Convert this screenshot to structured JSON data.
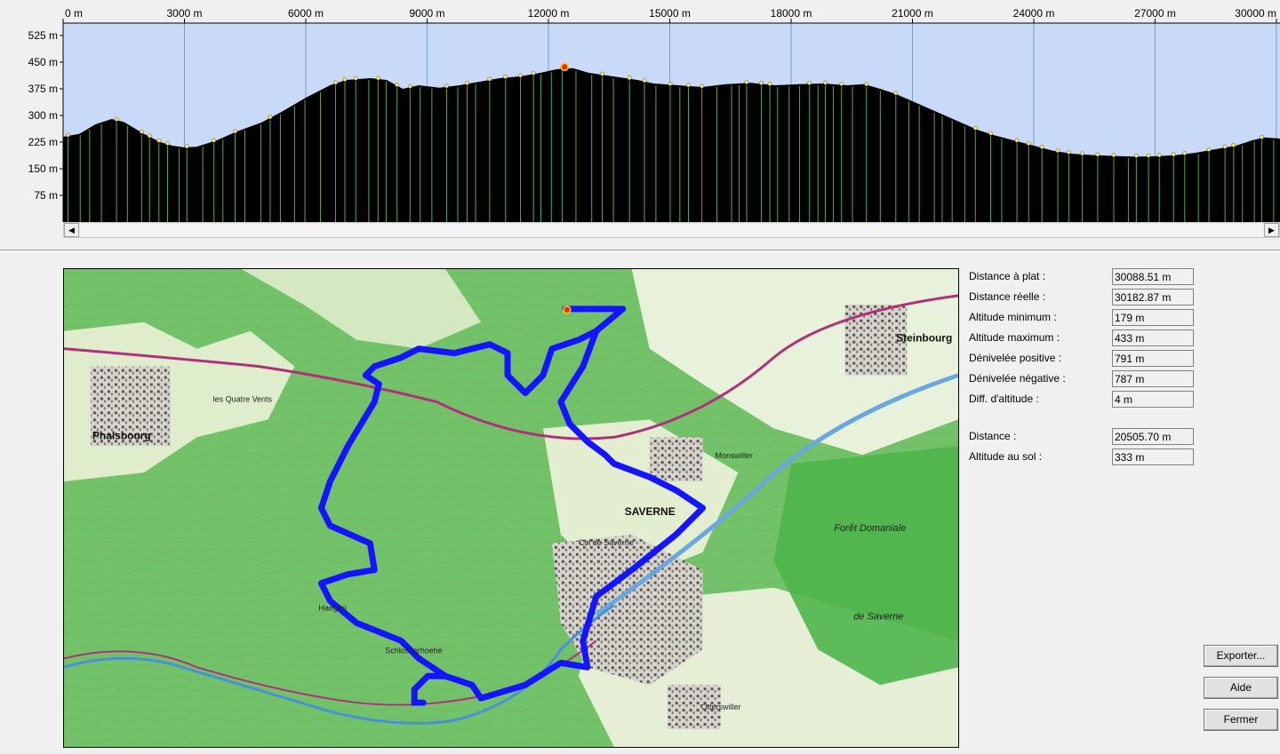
{
  "profile": {
    "x_ticks": [
      {
        "value": 0,
        "label": "0 m"
      },
      {
        "value": 3000,
        "label": "3000 m"
      },
      {
        "value": 6000,
        "label": "6000 m"
      },
      {
        "value": 9000,
        "label": "9000 m"
      },
      {
        "value": 12000,
        "label": "12000 m"
      },
      {
        "value": 15000,
        "label": "15000 m"
      },
      {
        "value": 18000,
        "label": "18000 m"
      },
      {
        "value": 21000,
        "label": "21000 m"
      },
      {
        "value": 24000,
        "label": "24000 m"
      },
      {
        "value": 27000,
        "label": "27000 m"
      },
      {
        "value": 30000,
        "label": "30000 m"
      }
    ],
    "y_ticks": [
      {
        "value": 525,
        "label": "525 m"
      },
      {
        "value": 450,
        "label": "450 m"
      },
      {
        "value": 375,
        "label": "375 m"
      },
      {
        "value": 300,
        "label": "300 m"
      },
      {
        "value": 225,
        "label": "225 m"
      },
      {
        "value": 150,
        "label": "150 m"
      },
      {
        "value": 75,
        "label": "75 m"
      }
    ],
    "colors": {
      "sky": "#c8daf8",
      "ground": "#000000",
      "grid": "#7a9bd0",
      "markers": "#5aa55a",
      "points": "#ffe066",
      "current_point": "#e83010"
    },
    "current_position_m": 12400,
    "elevation_profile": [
      [
        0,
        240
      ],
      [
        400,
        248
      ],
      [
        800,
        275
      ],
      [
        1200,
        290
      ],
      [
        1500,
        282
      ],
      [
        2000,
        248
      ],
      [
        2400,
        225
      ],
      [
        2700,
        215
      ],
      [
        3000,
        210
      ],
      [
        3300,
        212
      ],
      [
        3800,
        230
      ],
      [
        4300,
        255
      ],
      [
        4900,
        280
      ],
      [
        5400,
        310
      ],
      [
        6000,
        350
      ],
      [
        6600,
        385
      ],
      [
        7000,
        400
      ],
      [
        7600,
        405
      ],
      [
        8000,
        400
      ],
      [
        8400,
        375
      ],
      [
        8800,
        385
      ],
      [
        9300,
        378
      ],
      [
        9800,
        385
      ],
      [
        10300,
        395
      ],
      [
        10800,
        405
      ],
      [
        11300,
        410
      ],
      [
        11800,
        420
      ],
      [
        12200,
        430
      ],
      [
        12600,
        433
      ],
      [
        13000,
        420
      ],
      [
        13600,
        410
      ],
      [
        14200,
        400
      ],
      [
        14600,
        390
      ],
      [
        15200,
        385
      ],
      [
        15800,
        380
      ],
      [
        16400,
        388
      ],
      [
        17000,
        392
      ],
      [
        17600,
        385
      ],
      [
        18200,
        388
      ],
      [
        18800,
        390
      ],
      [
        19400,
        385
      ],
      [
        19800,
        388
      ],
      [
        20200,
        375
      ],
      [
        20600,
        360
      ],
      [
        21000,
        340
      ],
      [
        21400,
        320
      ],
      [
        21800,
        300
      ],
      [
        22200,
        280
      ],
      [
        22600,
        260
      ],
      [
        23000,
        245
      ],
      [
        23500,
        230
      ],
      [
        24000,
        215
      ],
      [
        24500,
        200
      ],
      [
        25000,
        192
      ],
      [
        25500,
        188
      ],
      [
        26000,
        186
      ],
      [
        26500,
        184
      ],
      [
        27000,
        185
      ],
      [
        27500,
        188
      ],
      [
        28000,
        195
      ],
      [
        28500,
        205
      ],
      [
        29000,
        215
      ],
      [
        29400,
        230
      ],
      [
        29700,
        238
      ],
      [
        30088,
        235
      ]
    ]
  },
  "stats": [
    {
      "label": "Distance à plat :",
      "value": "30088.51 m"
    },
    {
      "label": "Distance réelle :",
      "value": "30182.87 m"
    },
    {
      "label": "Altitude minimum :",
      "value": "179 m"
    },
    {
      "label": "Altitude maximum :",
      "value": "433 m"
    },
    {
      "label": "Dénivelée positive :",
      "value": "791 m"
    },
    {
      "label": "Dénivelée négative :",
      "value": "787 m"
    },
    {
      "label": "Diff. d'altitude :",
      "value": "4 m"
    },
    {
      "label": "Distance :",
      "value": "20505.70 m"
    },
    {
      "label": "Altitude au sol :",
      "value": "333 m"
    }
  ],
  "buttons": {
    "export": "Exporter...",
    "help": "Aide",
    "close": "Fermer"
  },
  "map": {
    "labels": {
      "phalsbourg": "Phalsbourg",
      "saverne": "SAVERNE",
      "steinbourg": "Steinbourg",
      "monswiller": "Monswiller",
      "otterswiller": "Otterswiller",
      "foret": "Forêt Domaniale",
      "de_saverne": "de Saverne",
      "quatre_vents": "les Quatre Vents",
      "schlosserhoehe": "Schlosserhoehe",
      "haegen": "Haegen",
      "col": "Col de Saverne"
    },
    "colors": {
      "route": "#1414ff",
      "forest": "#5cbf5c",
      "clearing": "#e6efd2",
      "town": "#9a9a9a",
      "road": "#8b2e5a"
    }
  }
}
